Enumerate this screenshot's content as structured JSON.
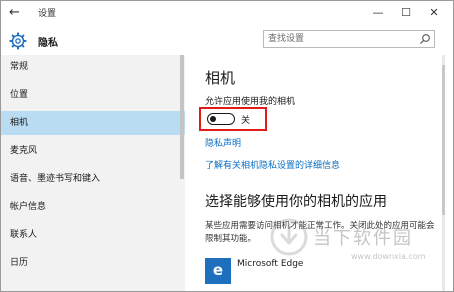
{
  "window": {
    "title": "设置",
    "back_icon": "back-arrow-icon",
    "controls": {
      "minimize": "—",
      "maximize": "☐",
      "close": "✕"
    }
  },
  "header": {
    "title": "隐私",
    "icon": "gear-icon"
  },
  "search": {
    "placeholder": "查找设置",
    "icon": "search-icon"
  },
  "sidebar": {
    "items": [
      {
        "label": "常规"
      },
      {
        "label": "位置"
      },
      {
        "label": "相机",
        "selected": true
      },
      {
        "label": "麦克风"
      },
      {
        "label": "语音、墨迹书写和键入"
      },
      {
        "label": "帐户信息"
      },
      {
        "label": "联系人"
      },
      {
        "label": "日历"
      }
    ]
  },
  "content": {
    "heading": "相机",
    "allow_label": "允许应用使用我的相机",
    "toggle": {
      "state_label": "关",
      "on": false
    },
    "privacy_link": "隐私声明",
    "learn_more_link": "了解有关相机隐私设置的详细信息",
    "apps_heading": "选择能够使用你的相机的应用",
    "apps_description": "某些应用需要访问相机才能正常工作。关闭此处的应用可能会限制其功能。",
    "apps": [
      {
        "name": "Microsoft Edge",
        "icon_letter": "e",
        "icon": "edge-icon"
      }
    ]
  },
  "watermark": {
    "text": "当下软件园",
    "url": "www.downxia.com"
  },
  "colors": {
    "accent_link": "#0a6dc2",
    "selected_nav": "#b9dcf2",
    "highlight_box": "#e21a1a",
    "edge_blue": "#1f6fbf"
  }
}
